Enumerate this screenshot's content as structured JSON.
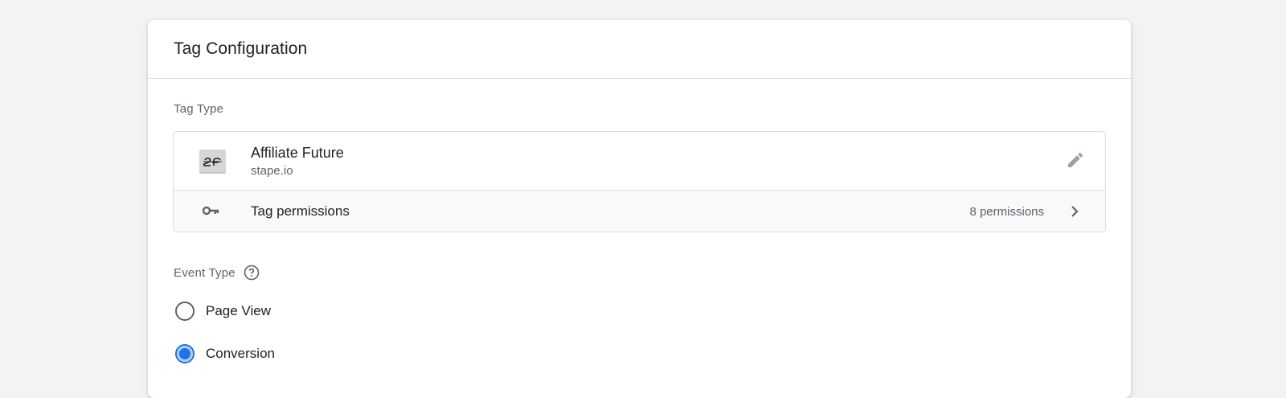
{
  "card": {
    "title": "Tag Configuration"
  },
  "tag_type": {
    "section_label": "Tag Type",
    "name": "Affiliate Future",
    "vendor": "stape.io",
    "logo_icon": "affiliate-future-logo",
    "edit_icon": "pencil-icon"
  },
  "permissions": {
    "label": "Tag permissions",
    "count": "8 permissions",
    "icon": "key-icon"
  },
  "event_type": {
    "section_label": "Event Type",
    "help_icon": "help-circle-icon",
    "options": [
      {
        "label": "Page View",
        "selected": false
      },
      {
        "label": "Conversion",
        "selected": true
      }
    ]
  },
  "colors": {
    "accent": "#1a73e8",
    "background": "#f1f3f4",
    "text_secondary": "#5f6368"
  }
}
